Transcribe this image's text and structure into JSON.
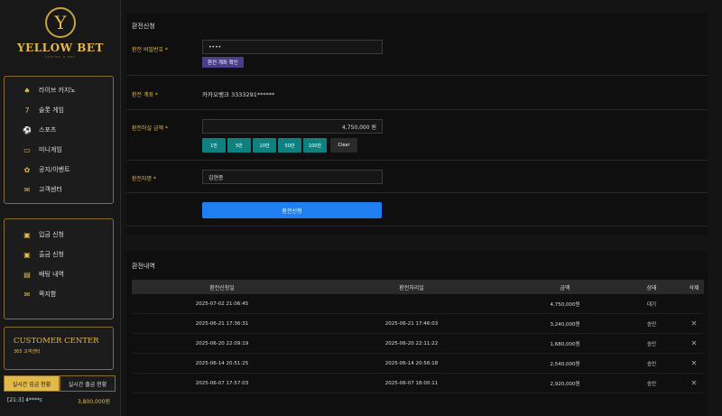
{
  "brand": {
    "emblem_letter": "Y",
    "name": "YELLOW BET",
    "sub": "CASINO & BET"
  },
  "sidebar": {
    "menu1": [
      {
        "label": "라이브 카지노",
        "icon": "spade-icon",
        "glyph": "♠"
      },
      {
        "label": "슬롯 게임",
        "icon": "slot-seven-icon",
        "glyph": "7"
      },
      {
        "label": "스포츠",
        "icon": "soccer-ball-icon",
        "glyph": "⚽"
      },
      {
        "label": "미니게임",
        "icon": "monitor-icon",
        "glyph": "▭"
      },
      {
        "label": "공지/이벤트",
        "icon": "gift-icon",
        "glyph": "✿"
      },
      {
        "label": "고객센터",
        "icon": "mail-icon",
        "glyph": "✉"
      }
    ],
    "menu2": [
      {
        "label": "입금 신청",
        "icon": "deposit-icon",
        "glyph": "▣"
      },
      {
        "label": "출금 신청",
        "icon": "withdraw-icon",
        "glyph": "▣"
      },
      {
        "label": "배팅 내역",
        "icon": "list-icon",
        "glyph": "▤"
      },
      {
        "label": "쪽지함",
        "icon": "message-icon",
        "glyph": "✉"
      }
    ],
    "customer_center": {
      "title": "CUSTOMER CENTER",
      "sub": "365 고객센터"
    },
    "realtime": {
      "tab_deposit": "실시간 입금 현황",
      "tab_withdraw": "실시간 출금 현황",
      "rows": [
        {
          "user": "[21:3] 4****c",
          "amount": "3,800,000원"
        }
      ]
    }
  },
  "form": {
    "title": "환전신청",
    "password_label": "환전 비밀번호 *",
    "password_value": "••••",
    "verify_button": "환전 계좌 확인",
    "account_label": "환전 계좌 *",
    "account_value": "카카오뱅크 3333291******",
    "amount_label": "환전하실 금액 *",
    "amount_value": "4,750,000 원",
    "amount_buttons": [
      "1만",
      "5만",
      "10만",
      "50만",
      "100만"
    ],
    "clear_button": "Clear",
    "holder_label": "환전자명 *",
    "holder_value": "김현종",
    "submit_button": "환전신청"
  },
  "history": {
    "title": "환전내역",
    "columns": [
      "환전신청일",
      "환전처리일",
      "금액",
      "상태",
      "삭제"
    ],
    "rows": [
      {
        "requested": "2025-07-02 21:06:45",
        "processed": "",
        "amount": "4,750,000원",
        "status": "대기",
        "deletable": false
      },
      {
        "requested": "2025-06-21 17:36:31",
        "processed": "2025-06-21 17:46:03",
        "amount": "3,240,000원",
        "status": "승인",
        "deletable": true
      },
      {
        "requested": "2025-06-20 22:09:19",
        "processed": "2025-06-20 22:11:22",
        "amount": "1,680,000원",
        "status": "승인",
        "deletable": true
      },
      {
        "requested": "2025-06-14 20:51:25",
        "processed": "2025-06-14 20:56:18",
        "amount": "2,540,000원",
        "status": "승인",
        "deletable": true
      },
      {
        "requested": "2025-06-07 17:57:03",
        "processed": "2025-06-07 18:00:11",
        "amount": "2,920,000원",
        "status": "승인",
        "deletable": true
      }
    ],
    "delete_glyph": "✕"
  }
}
